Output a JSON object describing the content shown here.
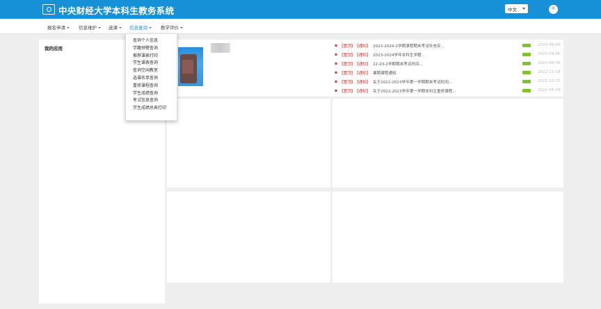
{
  "header": {
    "title": "中央财经大学本科生教务系统",
    "language": "中文"
  },
  "menu": {
    "items": [
      {
        "label": "报名申请"
      },
      {
        "label": "信息维护"
      },
      {
        "label": "选课"
      },
      {
        "label": "信息查询"
      },
      {
        "label": "教学评价"
      }
    ]
  },
  "dropdown": {
    "items": [
      "查询个人信息",
      "学籍预警查询",
      "推荐课表打印",
      "学生课表查询",
      "查询空闲教室",
      "选课名单查询",
      "重修课程查询",
      "学生成绩查询",
      "考试信息查询",
      "学生成绩总表打印"
    ]
  },
  "left_panel": {
    "title": "我的应用"
  },
  "notices": [
    {
      "tag1": "【置顶】",
      "tag2": "【通知】",
      "text": "2023-2024-2学期课程期末考试补充安...",
      "date": "2023-06-08"
    },
    {
      "tag1": "【置顶】",
      "tag2": "【通知】",
      "text": "2023-2024学年本科生学籍...",
      "date": "2023-04-06"
    },
    {
      "tag1": "【置顶】",
      "tag2": "【通知】",
      "text": "22-23-2学期期末考试时间...",
      "date": "2023-06-05"
    },
    {
      "tag1": "【置顶】",
      "tag2": "【通知】",
      "text": "暑期课程通知",
      "date": "2022-12-18"
    },
    {
      "tag1": "【置顶】",
      "tag2": "【通知】",
      "text": "关于2022-2023学年第一学期期末考试时间...",
      "date": "2022-10-17"
    },
    {
      "tag1": "【置顶】",
      "tag2": "【通知】",
      "text": "关于2022-2023学年第一学期本科生重修课程...",
      "date": "2022-09-09"
    }
  ]
}
